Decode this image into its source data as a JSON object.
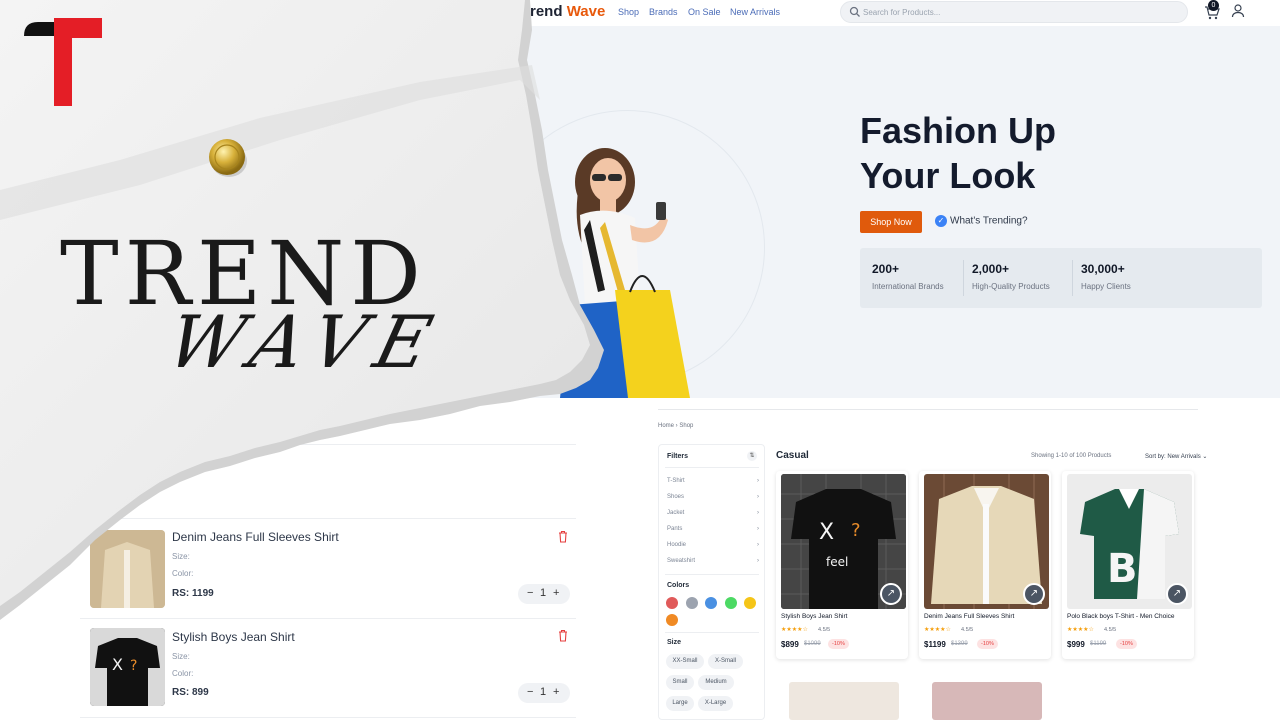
{
  "brand": {
    "logo_text_part1": "rend",
    "logo_text_part2": "Wave",
    "title_line1": "TREND",
    "title_line2": "WAVE"
  },
  "colors": {
    "accent": "#e05a0c",
    "brand_red": "#e41e26",
    "text_dark": "#141b2d"
  },
  "nav": {
    "links": [
      "Shop",
      "Brands",
      "On Sale",
      "New Arrivals"
    ],
    "search_placeholder": "Search for Products...",
    "cart_count": "0",
    "icons": [
      "search-icon",
      "cart-icon",
      "user-icon"
    ]
  },
  "hero": {
    "title_line1": "Fashion Up",
    "title_line2": "Your Look",
    "cta": "Shop Now",
    "trending": "What's Trending?",
    "stats": [
      {
        "value": "200+",
        "label": "International Brands"
      },
      {
        "value": "2,000+",
        "label": "High-Quality Products"
      },
      {
        "value": "30,000+",
        "label": "Happy Clients"
      }
    ]
  },
  "cart": {
    "items": [
      {
        "name": "Denim Jeans Full Sleeves Shirt",
        "size_label": "Size:",
        "color_label": "Color:",
        "price": "RS: 1199",
        "qty": "1"
      },
      {
        "name": "Stylish Boys Jean Shirt",
        "size_label": "Size:",
        "color_label": "Color:",
        "price": "RS: 899",
        "qty": "1"
      }
    ]
  },
  "shop": {
    "breadcrumb": [
      "Home",
      "Shop"
    ],
    "filters_title": "Filters",
    "categories": [
      "T-Shirt",
      "Shoes",
      "Jacket",
      "Pants",
      "Hoodie",
      "Sweatshirt"
    ],
    "colors_title": "Colors",
    "swatches": [
      "#e05a5a",
      "#9ca3af",
      "#4a90e2",
      "#4cd964",
      "#f5c518",
      "#f08a24"
    ],
    "size_title": "Size",
    "sizes": [
      "XX-Small",
      "X-Small",
      "Small",
      "Medium",
      "Large",
      "X-Large"
    ],
    "category_title": "Casual",
    "showing": "Showing 1-10 of 100 Products",
    "sort_label": "Sort by:",
    "sort_value": "New Arrivals",
    "products": [
      {
        "name": "Stylish Boys Jean Shirt",
        "rating": "4.5/5",
        "price": "$899",
        "original": "$1099",
        "discount": "-10%"
      },
      {
        "name": "Denim Jeans Full Sleeves Shirt",
        "rating": "4.5/5",
        "price": "$1199",
        "original": "$1399",
        "discount": "-10%"
      },
      {
        "name": "Polo Black boys T-Shirt - Men Choice",
        "rating": "4.5/5",
        "price": "$999",
        "original": "$1199",
        "discount": "-10%"
      }
    ]
  }
}
